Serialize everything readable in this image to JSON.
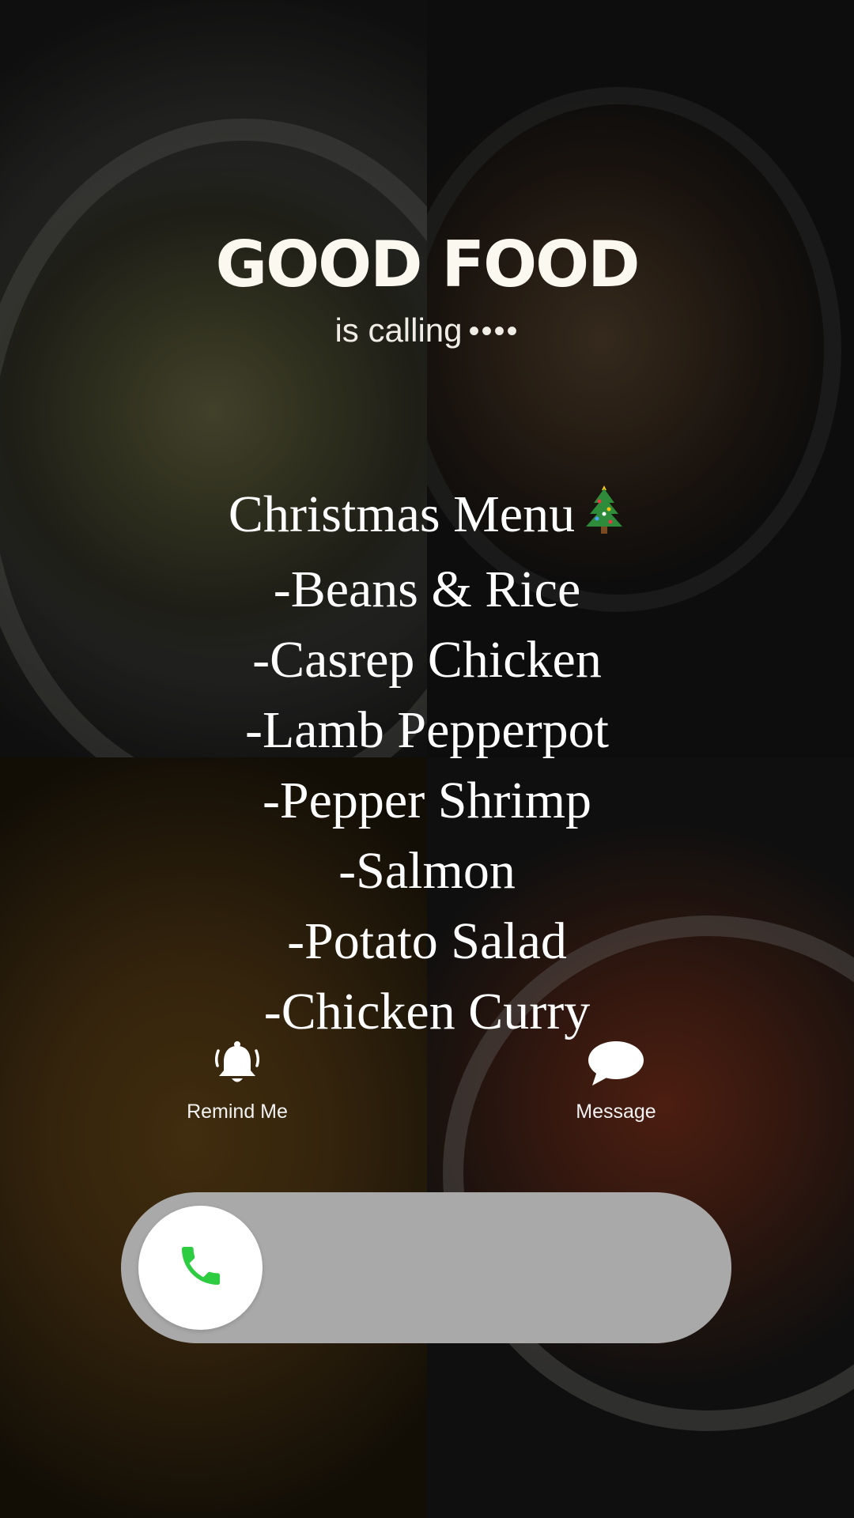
{
  "headline": "GOOD FOOD",
  "subtitle": "is calling",
  "subtitle_dots": "••••",
  "menu": {
    "title": "Christmas Menu",
    "title_icon": "christmas-tree-icon",
    "items": [
      "-Beans & Rice",
      "-Casrep Chicken",
      "-Lamb Pepperpot",
      "-Pepper Shrimp",
      "-Salmon",
      "-Potato Salad",
      "-Chicken Curry"
    ]
  },
  "actions": {
    "remind": {
      "label": "Remind Me",
      "icon": "bell-icon"
    },
    "message": {
      "label": "Message",
      "icon": "chat-bubble-icon"
    }
  },
  "slider": {
    "icon": "phone-icon",
    "icon_color": "#2ecc40",
    "track_color": "#a9a9a9"
  }
}
